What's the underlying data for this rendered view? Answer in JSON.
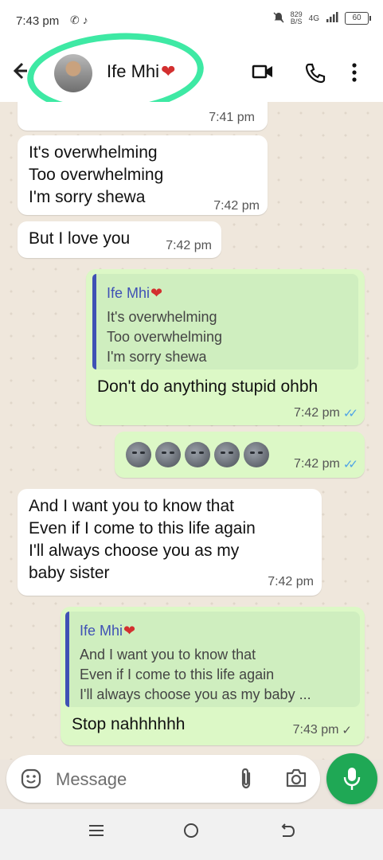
{
  "status_bar": {
    "time": "7:43 pm",
    "apps": "✆ ♪",
    "net_rate": "829",
    "net_unit": "B/S",
    "network": "4G",
    "battery": "60"
  },
  "header": {
    "contact_name": "Ife Mhi",
    "contact_emoji": "❤"
  },
  "messages": [
    {
      "time": "7:41 pm"
    },
    {
      "text": "It's overwhelming\nToo overwhelming\nI'm sorry shewa",
      "time": "7:42 pm"
    },
    {
      "text": "But I love you",
      "time": "7:42 pm"
    },
    {
      "quote_name": "Ife Mhi",
      "quote_emoji": "❤",
      "quote_text": "It's overwhelming\nToo overwhelming\nI'm sorry shewa",
      "text": "Don't do anything stupid ohbh",
      "time": "7:42 pm",
      "status": "read"
    },
    {
      "emoji_count": 5,
      "time": "7:42 pm",
      "status": "read"
    },
    {
      "text": "And I want you to know that\nEven if I come to this life again\nI'll always choose you as my\nbaby sister",
      "time": "7:42 pm"
    },
    {
      "quote_name": "Ife Mhi",
      "quote_emoji": "❤",
      "quote_text": "And I want you to know that\nEven if I come to this life again\nI'll always choose you as my baby ...",
      "text": "Stop nahhhhhh",
      "time": "7:43 pm",
      "status": "sent"
    }
  ],
  "composer": {
    "placeholder": "Message"
  },
  "colors": {
    "accent": "#1fa855",
    "incoming": "#ffffff",
    "outgoing": "#dcf8c6",
    "quote_name": "#3f51b5",
    "read_ticks": "#4fa3e6",
    "highlight_ring": "#3ee9a4"
  },
  "icons": [
    "back-arrow-icon",
    "video-call-icon",
    "phone-icon",
    "more-menu-icon",
    "emoji-icon",
    "attach-icon",
    "camera-icon",
    "mic-icon",
    "nav-menu-icon",
    "nav-home-icon",
    "nav-back-icon"
  ]
}
